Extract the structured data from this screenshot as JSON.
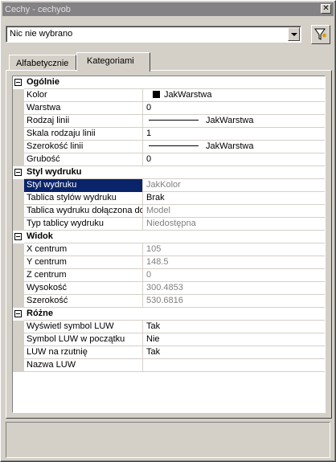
{
  "window": {
    "title": "Cechy - cechyob"
  },
  "selector": {
    "value": "Nic nie wybrano"
  },
  "tabs": [
    {
      "label": "Alfabetycznie",
      "active": false
    },
    {
      "label": "Kategoriami",
      "active": true
    }
  ],
  "categories": [
    {
      "name": "Ogólnie",
      "rows": [
        {
          "name": "Kolor",
          "value": "JakWarstwa",
          "kind": "color",
          "dim": false
        },
        {
          "name": "Warstwa",
          "value": "0",
          "kind": "text",
          "dim": false
        },
        {
          "name": "Rodzaj linii",
          "value": "JakWarstwa",
          "kind": "line",
          "dim": false
        },
        {
          "name": "Skala rodzaju linii",
          "value": "1",
          "kind": "text",
          "dim": false
        },
        {
          "name": "Szerokość linii",
          "value": "JakWarstwa",
          "kind": "line",
          "dim": false
        },
        {
          "name": "Grubość",
          "value": "0",
          "kind": "text",
          "dim": false
        }
      ]
    },
    {
      "name": "Styl wydruku",
      "rows": [
        {
          "name": "Styl wydruku",
          "value": "JakKolor",
          "kind": "text",
          "dim": true,
          "selected": true
        },
        {
          "name": "Tablica stylów wydruku",
          "value": "Brak",
          "kind": "text",
          "dim": false
        },
        {
          "name": "Tablica wydruku dołączona do",
          "value": "Model",
          "kind": "text",
          "dim": true
        },
        {
          "name": "Typ tablicy wydruku",
          "value": "Niedostępna",
          "kind": "text",
          "dim": true
        }
      ]
    },
    {
      "name": "Widok",
      "rows": [
        {
          "name": "X centrum",
          "value": "105",
          "kind": "text",
          "dim": true
        },
        {
          "name": "Y centrum",
          "value": "148.5",
          "kind": "text",
          "dim": true
        },
        {
          "name": "Z centrum",
          "value": "0",
          "kind": "text",
          "dim": true
        },
        {
          "name": "Wysokość",
          "value": "300.4853",
          "kind": "text",
          "dim": true
        },
        {
          "name": "Szerokość",
          "value": "530.6816",
          "kind": "text",
          "dim": true
        }
      ]
    },
    {
      "name": "Różne",
      "rows": [
        {
          "name": "Wyświetl symbol LUW",
          "value": "Tak",
          "kind": "text",
          "dim": false
        },
        {
          "name": "Symbol LUW w początku",
          "value": "Nie",
          "kind": "text",
          "dim": false
        },
        {
          "name": "LUW na rzutnię",
          "value": "Tak",
          "kind": "text",
          "dim": false
        },
        {
          "name": "Nazwa LUW",
          "value": "",
          "kind": "text",
          "dim": false
        }
      ]
    }
  ],
  "icons": {
    "close": "close-icon",
    "quick_select": "quick-select-funnel-icon",
    "dropdown": "chevron-down-icon"
  },
  "colors": {
    "titlebar": "#848284",
    "selection": "#0a246a",
    "face": "#d4d0c8",
    "disabled_text": "#808080"
  }
}
